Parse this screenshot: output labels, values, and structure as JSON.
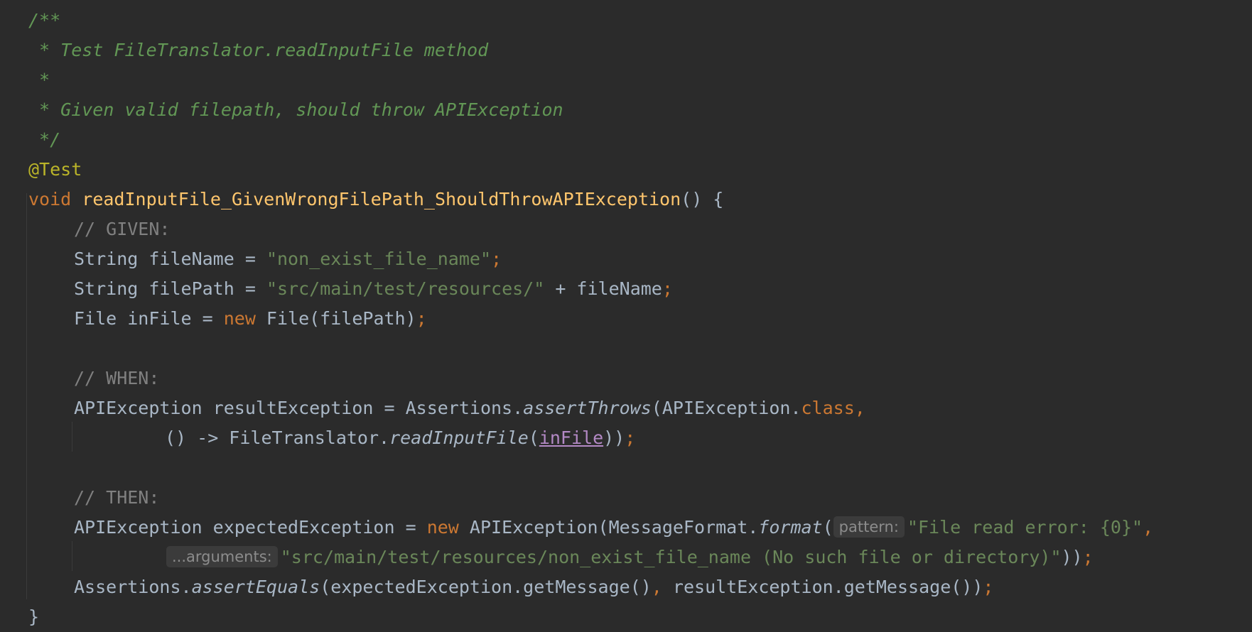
{
  "editor": {
    "javadoc": {
      "open": "/**",
      "line1": " * Test FileTranslator.readInputFile method",
      "line2": " *",
      "line3": " * Given valid filepath, should throw APIException",
      "close": " */"
    },
    "annotation": "@Test",
    "method": {
      "keyword_void": "void",
      "name": "readInputFile_GivenWrongFilePath_ShouldThrowAPIException",
      "signature_tail": "() {"
    },
    "comment_given": "// GIVEN:",
    "line_filename": {
      "decl": "String fileName = ",
      "value": "\"non_exist_file_name\"",
      "semi": ";"
    },
    "line_filepath": {
      "decl": "String filePath = ",
      "value": "\"src/main/test/resources/\"",
      "tail": " + fileName",
      "semi": ";"
    },
    "line_infile": {
      "decl": "File inFile = ",
      "kw_new": "new",
      "tail": " File(filePath)",
      "semi": ";"
    },
    "comment_when": "// WHEN:",
    "line_result": {
      "decl": "APIException resultException = Assertions.",
      "method": "assertThrows",
      "args": "(APIException.",
      "kw_class": "class",
      "comma": ","
    },
    "line_lambda": {
      "head": "() -> FileTranslator.",
      "method": "readInputFile",
      "open": "(",
      "param": "inFile",
      "close": "))",
      "semi": ";"
    },
    "comment_then": "// THEN:",
    "line_expected": {
      "decl": "APIException expectedException = ",
      "kw_new": "new",
      "mid": " APIException(MessageFormat.",
      "method": "format",
      "open": "(",
      "hint_pattern": "pattern:",
      "value": "\"File read error: {0}\"",
      "comma": ","
    },
    "line_arguments": {
      "hint_arguments": "...arguments:",
      "value": "\"src/main/test/resources/non_exist_file_name (No such file or directory)\"",
      "close": "))",
      "semi": ";"
    },
    "line_assert": {
      "head": "Assertions.",
      "method": "assertEquals",
      "arg1": "(expectedException.getMessage()",
      "comma": ",",
      "arg2": " resultException.getMessage())",
      "semi": ";"
    },
    "closing_brace": "}"
  }
}
